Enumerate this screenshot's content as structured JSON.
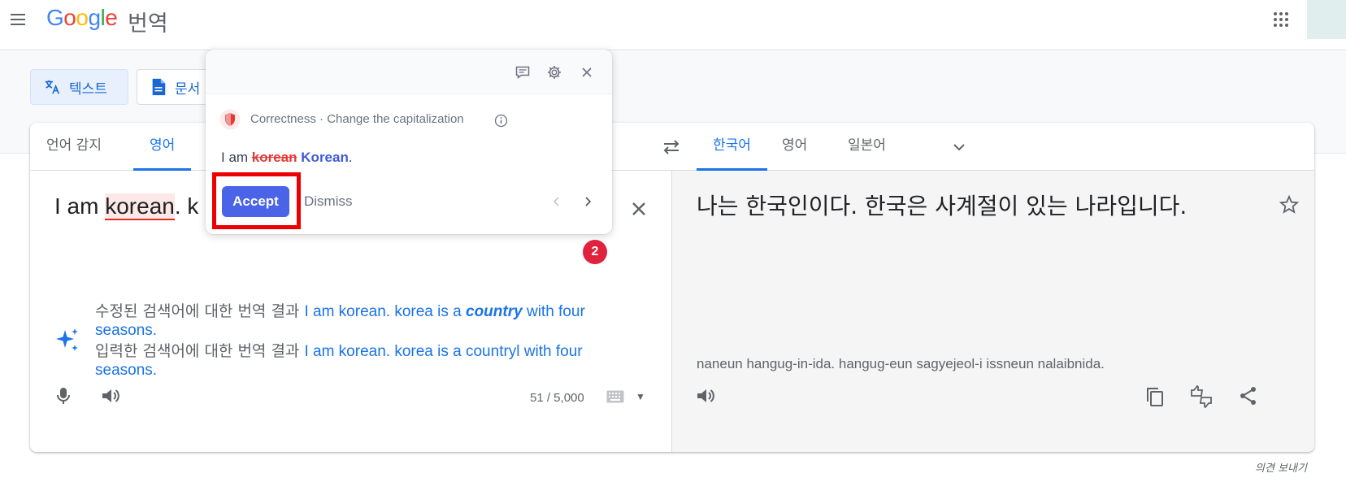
{
  "header": {
    "menu_icon": "hamburger-menu-icon",
    "logo_text": "Google",
    "product_name": "번역",
    "apps_icon": "apps-grid-icon"
  },
  "modes": [
    {
      "label": "텍스트",
      "icon": "translate-icon",
      "active": true
    },
    {
      "label": "문서",
      "icon": "document-icon",
      "active": false
    }
  ],
  "source_langs": [
    {
      "label": "언어 감지",
      "active": false
    },
    {
      "label": "영어",
      "active": true
    }
  ],
  "target_langs": [
    {
      "label": "한국어",
      "active": true
    },
    {
      "label": "영어",
      "active": false
    },
    {
      "label": "일본어",
      "active": false
    }
  ],
  "source": {
    "text_prefix": "I am ",
    "text_error": "korean",
    "text_suffix": ". k",
    "char_count": "51 / 5,000",
    "suggestions": [
      {
        "label": "수정된 검색어에 대한 번역 결과",
        "link_pre": "I am korean. korea is a ",
        "link_bold": "country",
        "link_post": " with four seasons."
      },
      {
        "label": "입력한 검색어에 대한 번역 결과",
        "link_pre": "I am korean. korea is a countryl with four seasons.",
        "link_bold": "",
        "link_post": ""
      }
    ]
  },
  "target": {
    "text": "나는 한국인이다. 한국은 사계절이 있는 나라입니다.",
    "romanization": "naneun hangug-in-ida. hangug-eun sagyejeol-i issneun nalaibnida."
  },
  "feedback_label": "의견 보내기",
  "popup": {
    "category": "Correctness · Change the capitalization",
    "sentence_prefix": "I am ",
    "sentence_wrong": "korean",
    "sentence_fix": "Korean",
    "sentence_suffix": ".",
    "accept_label": "Accept",
    "dismiss_label": "Dismiss",
    "highlight_color": "#ee0000"
  },
  "badge_count": "2",
  "colors": {
    "accent": "#1a73e8",
    "accept": "#4a63e7",
    "error": "#d93025",
    "badge": "#e0223c"
  }
}
